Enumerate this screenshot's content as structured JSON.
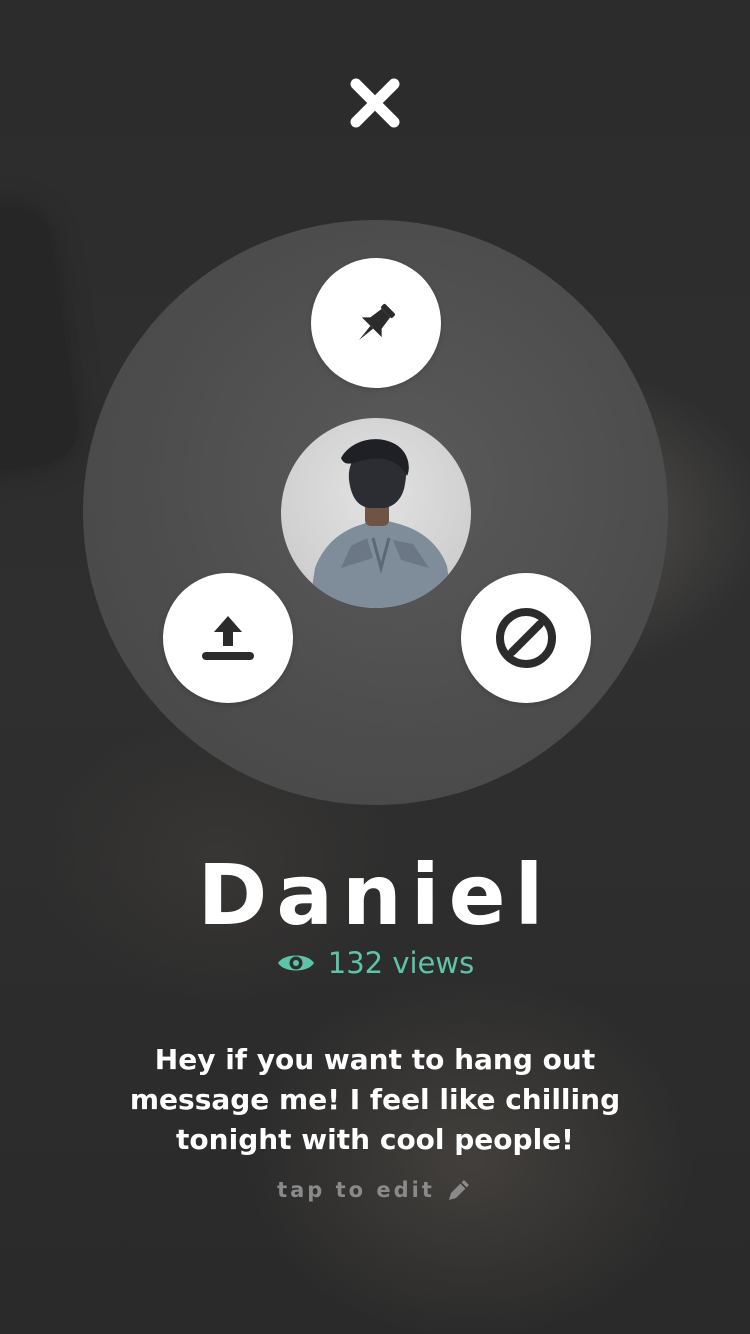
{
  "close": {
    "icon": "close-icon"
  },
  "actions": [
    {
      "name": "pin",
      "icon": "pin-icon"
    },
    {
      "name": "share",
      "icon": "upload-icon"
    },
    {
      "name": "block",
      "icon": "block-icon"
    }
  ],
  "profile": {
    "name": "Daniel",
    "views_text": "132 views",
    "views_icon": "eye-icon",
    "bio": "Hey if you want to hang out message me! I feel like chilling tonight with cool people!",
    "edit_hint": "tap to edit",
    "edit_icon": "pencil-icon"
  },
  "colors": {
    "accent": "#5ec4a9",
    "background": "#2e2e2e",
    "disc": "#4d4d4d",
    "button": "#ffffff",
    "icon": "#2b2b2b",
    "hint": "#8a8a8a"
  }
}
